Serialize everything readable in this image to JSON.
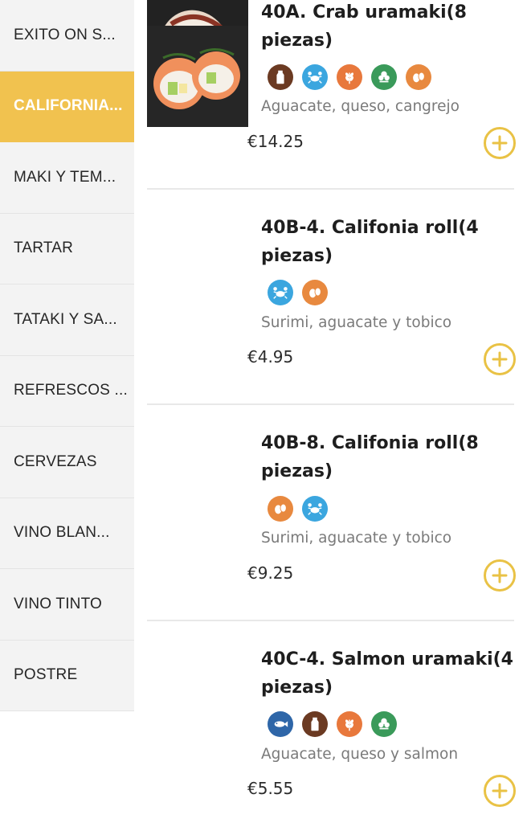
{
  "colors": {
    "accent": "#f1c24f",
    "add_button": "#e9c245"
  },
  "sidebar": {
    "items": [
      {
        "label": "EXITO ON S...",
        "active": false
      },
      {
        "label": "CALIFORNIA...",
        "active": true
      },
      {
        "label": "MAKI Y TEM...",
        "active": false
      },
      {
        "label": "TARTAR",
        "active": false
      },
      {
        "label": "TATAKI Y SA...",
        "active": false
      },
      {
        "label": "REFRESCOS ...",
        "active": false
      },
      {
        "label": "CERVEZAS",
        "active": false
      },
      {
        "label": "VINO BLAN...",
        "active": false
      },
      {
        "label": "VINO TINTO",
        "active": false
      },
      {
        "label": "POSTRE",
        "active": false
      }
    ]
  },
  "products": [
    {
      "name": "40A. Crab uramaki(8 piezas)",
      "allergens": [
        "dairy-icon",
        "crab-icon",
        "gluten-icon",
        "vegetable-icon",
        "egg-icon"
      ],
      "description": "Aguacate, queso, cangrejo",
      "price": "€14.25"
    },
    {
      "name": "40B-4. Califonia roll(4 piezas)",
      "allergens": [
        "crab-icon",
        "egg-icon"
      ],
      "description": "Surimi, aguacate y tobico",
      "price": "€4.95"
    },
    {
      "name": "40B-8. Califonia roll(8 piezas)",
      "allergens": [
        "egg-icon",
        "crab-icon"
      ],
      "description": "Surimi, aguacate y tobico",
      "price": "€9.25"
    },
    {
      "name": "40C-4. Salmon uramaki(4 piezas)",
      "allergens": [
        "fish-icon",
        "dairy-icon",
        "gluten-icon",
        "vegetable-icon"
      ],
      "description": "Aguacate, queso y salmon",
      "price": "€5.55"
    }
  ]
}
